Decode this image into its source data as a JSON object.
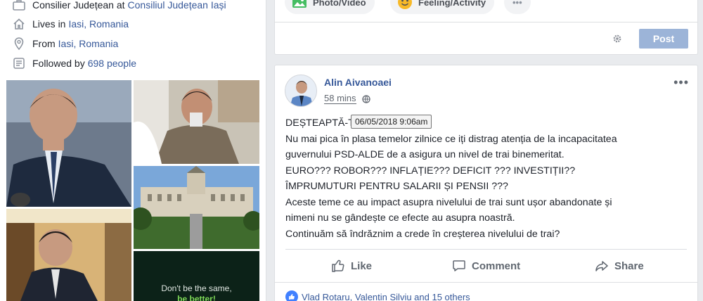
{
  "intro": {
    "work": {
      "prefix": "Consilier Județean at",
      "link": "Consiliul Județean Iași"
    },
    "lives": {
      "prefix": "Lives in",
      "link": "Iasi, Romania"
    },
    "from": {
      "prefix": "From",
      "link": "Iasi, Romania"
    },
    "followed": {
      "prefix": "Followed by",
      "link": "698 people"
    }
  },
  "photos": {
    "quote_line1": "Don't be the same,",
    "quote_line2": "be better!"
  },
  "composer": {
    "photo_video": "Photo/Video",
    "feeling_activity": "Feeling/Activity",
    "more": "•••",
    "post_button": "Post"
  },
  "post": {
    "author": "Alin Aivanoaei",
    "time": "58 mins",
    "tooltip": "06/05/2018 9:06am",
    "menu": "•••",
    "lines": [
      "DEȘTEAPTĂ-TE ROMÂNE!",
      "Nu mai pica în plasa temelor zilnice ce iți distrag atenția de la incapacitatea",
      "guvernului PSD-ALDE de a asigura un nivel de trai binemeritat.",
      "EURO??? ROBOR??? INFLAȚIE??? DEFICIT ??? INVESTIȚII??",
      "ÎMPRUMUTURI PENTRU SALARII ȘI PENSII ???",
      "Aceste teme ce au impact asupra nivelului de trai sunt ușor abandonate și",
      "nimeni nu se gândește ce efecte au asupra noastră.",
      "Continuăm să îndrăznim a crede în creșterea nivelului de trai?"
    ],
    "actions": {
      "like": "Like",
      "comment": "Comment",
      "share": "Share"
    },
    "reactions": "Vlad Rotaru, Valentin Silviu and 15 others"
  },
  "colors": {
    "link": "#365899",
    "accent": "#4080ff",
    "post_button": "#9cb4d8"
  }
}
